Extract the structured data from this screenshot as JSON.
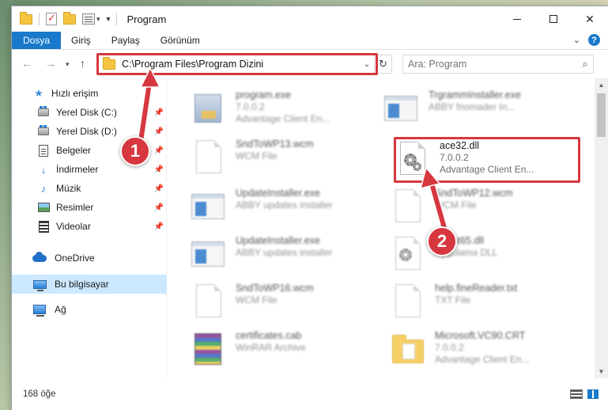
{
  "window": {
    "title": "Program"
  },
  "ribbon": {
    "tabs": [
      {
        "label": "Dosya"
      },
      {
        "label": "Giriş"
      },
      {
        "label": "Paylaş"
      },
      {
        "label": "Görünüm"
      }
    ]
  },
  "address": {
    "path": "C:\\Program Files\\Program Dizini"
  },
  "search": {
    "placeholder": "Ara: Program"
  },
  "sidebar": {
    "items": [
      {
        "label": "Hızlı erişim",
        "icon": "star-icon"
      },
      {
        "label": "Yerel Disk (C:)",
        "icon": "drive-icon"
      },
      {
        "label": "Yerel Disk (D:)",
        "icon": "drive-icon"
      },
      {
        "label": "Belgeler",
        "icon": "documents-icon"
      },
      {
        "label": "İndirmeler",
        "icon": "download-icon"
      },
      {
        "label": "Müzik",
        "icon": "music-icon"
      },
      {
        "label": "Resimler",
        "icon": "pictures-icon"
      },
      {
        "label": "Videolar",
        "icon": "videos-icon"
      },
      {
        "label": "OneDrive",
        "icon": "cloud-icon"
      },
      {
        "label": "Bu bilgisayar",
        "icon": "computer-icon"
      },
      {
        "label": "Ağ",
        "icon": "network-icon"
      }
    ]
  },
  "files": [
    {
      "name": "program.exe",
      "line2": "7.0.0.2",
      "line3": "Advantage Client En...",
      "icon": "setup-icon"
    },
    {
      "name": "TrgrammInstaller.exe",
      "line2": "ABBY fnomader In...",
      "line3": "",
      "icon": "exe-icon"
    },
    {
      "name": "SndToWP13.wcm",
      "line2": "WCM File",
      "line3": "",
      "icon": "file-icon"
    },
    {
      "name": "ace32.dll",
      "line2": "7.0.0.2",
      "line3": "Advantage Client En...",
      "icon": "dll-icon"
    },
    {
      "name": "UpdateInstaller.exe",
      "line2": "ABBY updates installer",
      "line3": "",
      "icon": "exe-icon"
    },
    {
      "name": "SndToWP12.wcm",
      "line2": "WCM File",
      "line3": "",
      "icon": "file-icon"
    },
    {
      "name": "UpdateInstaller.exe",
      "line2": "ABBY updates installer",
      "line3": "",
      "icon": "exe-icon"
    },
    {
      "name": "Client65.dll",
      "line2": "Uygulama DLL",
      "line3": "",
      "icon": "dll-icon"
    },
    {
      "name": "SndToWP16.wcm",
      "line2": "WCM File",
      "line3": "",
      "icon": "file-icon"
    },
    {
      "name": "help.fineReader.txt",
      "line2": "TXT File",
      "line3": "",
      "icon": "file-icon"
    },
    {
      "name": "certificates.cab",
      "line2": "WinRAR Archive",
      "line3": "",
      "icon": "archive-icon"
    },
    {
      "name": "Microsoft.VC90.CRT",
      "line2": "7.0.0.2",
      "line3": "Advantage Client En...",
      "icon": "folder-icon"
    }
  ],
  "status": {
    "count": "168 öğe"
  },
  "markers": {
    "one": "1",
    "two": "2"
  },
  "colors": {
    "accent": "#1979ca",
    "highlight": "#d7373f",
    "selected": "#cce8ff"
  }
}
